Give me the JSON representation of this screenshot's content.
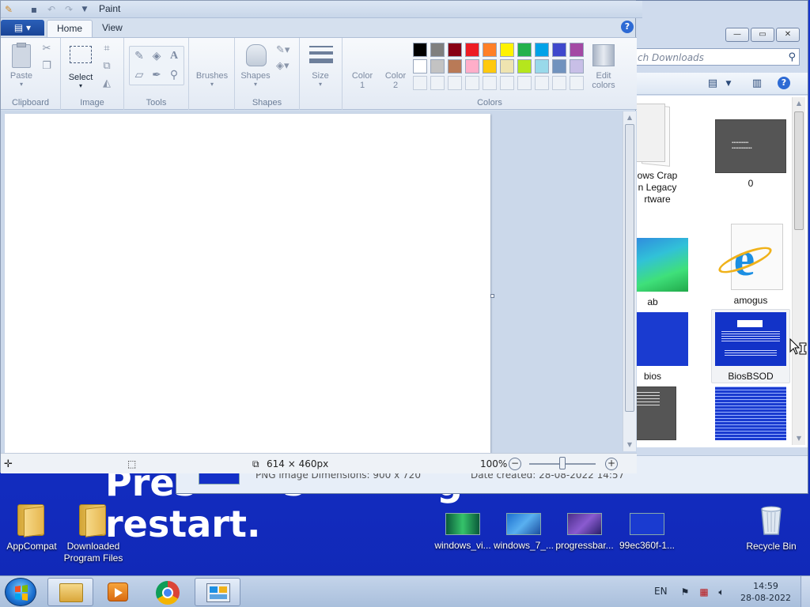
{
  "paint": {
    "title": "Paint",
    "tabs": {
      "home": "Home",
      "view": "View"
    },
    "help": "?",
    "groups": {
      "clipboard": "Clipboard",
      "image": "Image",
      "tools": "Tools",
      "shapes": "Shapes",
      "colors": "Colors"
    },
    "buttons": {
      "paste": "Paste",
      "select": "Select",
      "brushes": "Brushes",
      "shapes": "Shapes",
      "size": "Size",
      "color1_a": "Color",
      "color1_b": "1",
      "color2_a": "Color",
      "color2_b": "2",
      "edit_colors_a": "Edit",
      "edit_colors_b": "colors"
    },
    "palette_row1": [
      "#000000",
      "#7f7f7f",
      "#880015",
      "#ed1c24",
      "#ff7f27",
      "#fff200",
      "#22b14c",
      "#00a2e8",
      "#3f48cc",
      "#a349a4"
    ],
    "palette_row2": [
      "#ffffff",
      "#c3c3c3",
      "#b97a57",
      "#ffaec9",
      "#ffc90e",
      "#efe4b0",
      "#b5e61d",
      "#99d9ea",
      "#7092be",
      "#c8bfe7"
    ],
    "status": {
      "selection_size": "",
      "canvas_size": "614 × 460px",
      "zoom": "100%",
      "zoom_level_percent": 100
    }
  },
  "explorer": {
    "search_placeholder": "ch Downloads",
    "items": [
      {
        "label": "ows Crap\nn Legacy\nrtware"
      },
      {
        "label": "0"
      },
      {
        "label": "ab"
      },
      {
        "label": "amogus"
      },
      {
        "label": "bios"
      },
      {
        "label": "BiosBSOD"
      }
    ],
    "details": {
      "type": "PNG image  Dimensions: 900 x 720",
      "date": "Date created: 28-08-2022 14:57"
    }
  },
  "desktop": {
    "bsod_line1": "Pres",
    "bsod_line1b": "s",
    "bsod_line1c": "g",
    "bsod_line2": "restart.",
    "icons": [
      {
        "label": "AppCompat"
      },
      {
        "label": "Downloaded Program Files"
      },
      {
        "label": "windows_vi..."
      },
      {
        "label": "windows_7_..."
      },
      {
        "label": "progressbar..."
      },
      {
        "label": "99ec360f-1..."
      },
      {
        "label": "Recycle Bin"
      }
    ]
  },
  "taskbar": {
    "lang": "EN",
    "time": "14:59",
    "date": "28-08-2022"
  },
  "colors": {
    "desktop_blue": "#1430c8",
    "taskbar": "#b8cbe4",
    "ribbon": "#eef3f9"
  }
}
